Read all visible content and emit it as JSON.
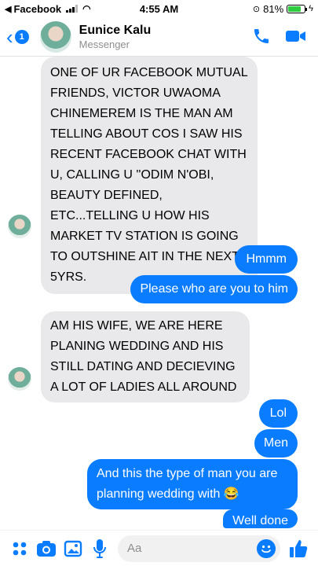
{
  "status_bar": {
    "back_app": "Facebook",
    "time": "4:55 AM",
    "battery": "81%",
    "battery_level": 0.81
  },
  "header": {
    "back_count": "1",
    "contact_name": "Eunice Kalu",
    "contact_sub": "Messenger"
  },
  "messages": [
    {
      "from": "them",
      "text": "ONE OF UR FACEBOOK MUTUAL FRIENDS, VICTOR UWAOMA CHINEMEREM IS THE MAN AM TELLING ABOUT COS I SAW HIS RECENT FACEBOOK CHAT WITH U, CALLING U ''ODIM N'OBI, BEAUTY DEFINED, ETC...TELLING U HOW HIS MARKET TV STATION IS GOING TO OUTSHINE AIT IN THE NEXT 5YRS."
    },
    {
      "from": "me",
      "text": "Hmmm"
    },
    {
      "from": "me",
      "text": "Please who are you to him"
    },
    {
      "from": "them",
      "text": "AM HIS WIFE, WE ARE HERE PLANING WEDDING AND HIS STILL DATING AND DECIEVING A LOT OF LADIES ALL AROUND"
    },
    {
      "from": "me",
      "text": "Lol"
    },
    {
      "from": "me",
      "text": "Men"
    },
    {
      "from": "me",
      "text": "And this the type of man you are planning wedding with 😂"
    },
    {
      "from": "me",
      "text": "Well done"
    }
  ],
  "composer": {
    "placeholder": "Aa"
  },
  "icons": {
    "back": "chevron-left-icon",
    "call": "phone-icon",
    "video": "video-camera-icon",
    "more": "four-dots-icon",
    "camera": "camera-icon",
    "gallery": "image-icon",
    "mic": "microphone-icon",
    "emoji": "emoji-icon",
    "like": "thumbs-up-icon"
  },
  "colors": {
    "accent": "#0a7cff",
    "incoming_bubble": "#e9e9eb"
  }
}
